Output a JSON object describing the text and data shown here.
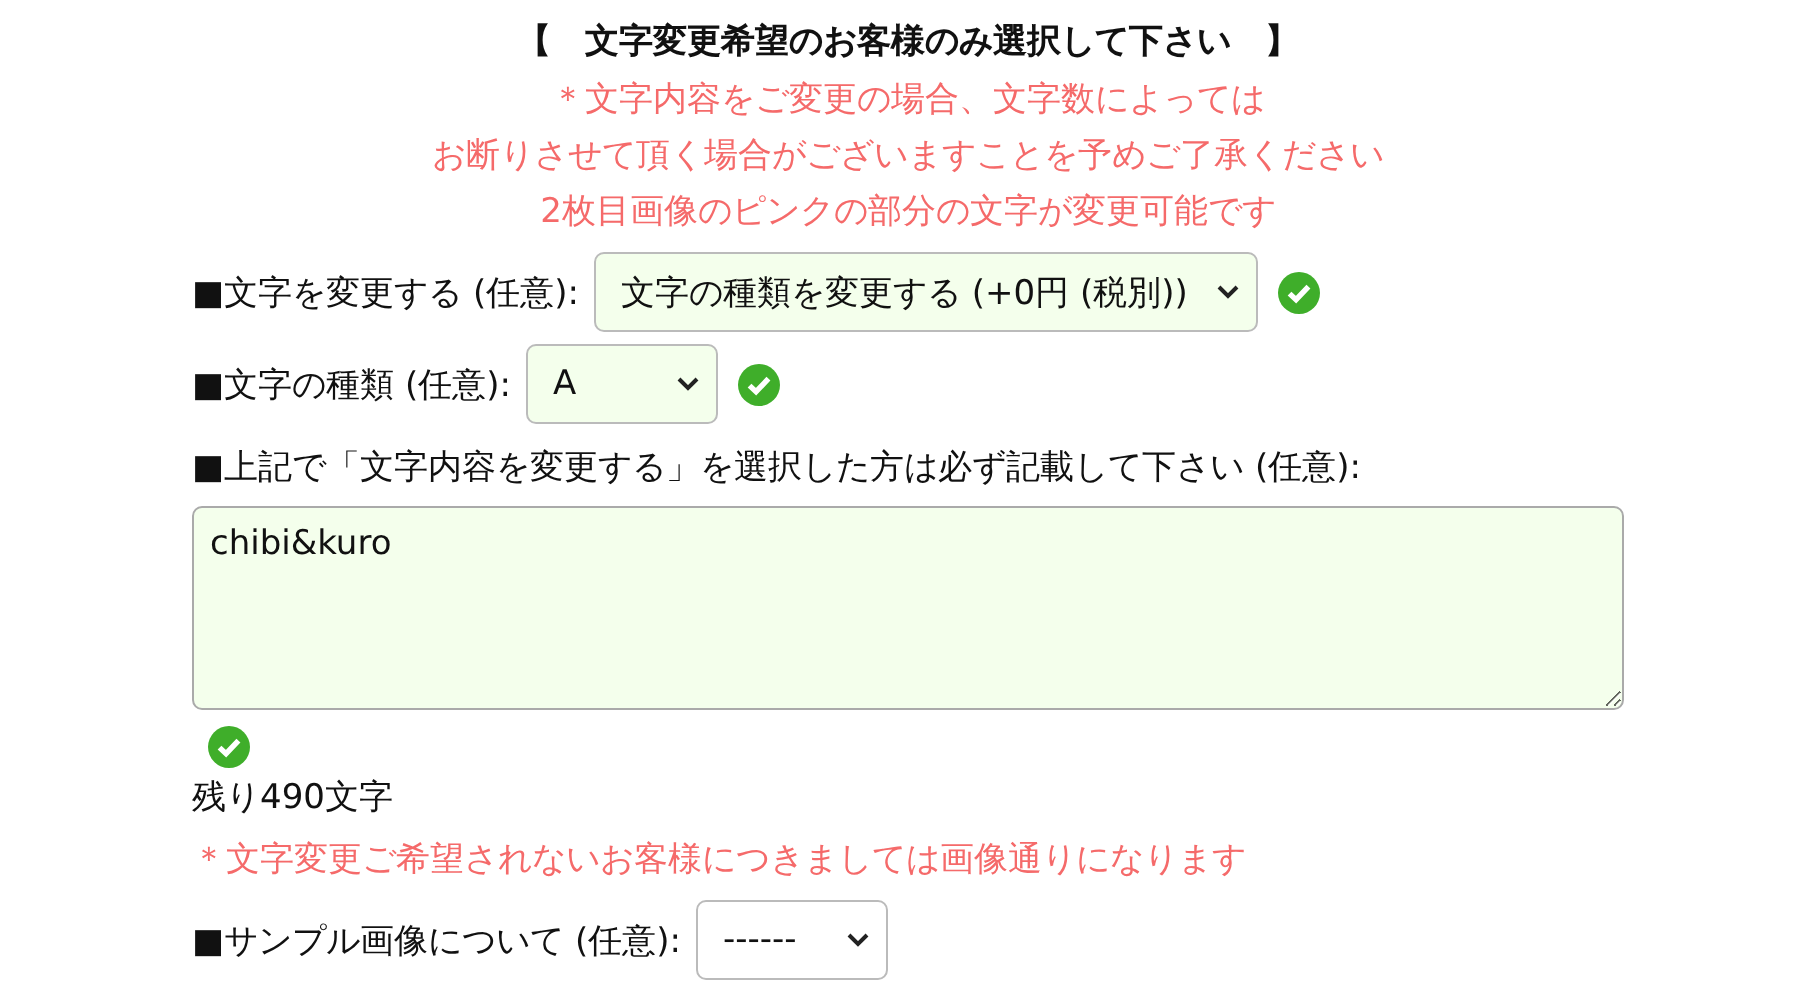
{
  "heading": "【　文字変更希望のお客様のみ選択して下さい　】",
  "notes": [
    "＊文字内容をご変更の場合、文字数によっては",
    "お断りさせて頂く場合がございますことを予めご了承ください",
    "2枚目画像のピンクの部分の文字が変更可能です"
  ],
  "fields": [
    {
      "kind": "select",
      "label": "■文字を変更する (任意):",
      "value": "文字の種類を変更する (+0円 (税別))",
      "valid": true
    },
    {
      "kind": "select",
      "label": "■文字の種類 (任意):",
      "value": "A",
      "valid": true
    },
    {
      "kind": "textarea",
      "label": "■上記で「文字内容を変更する」を選択した方は必ず記載して下さい (任意):",
      "value": "chibi&kuro",
      "valid": true,
      "remaining": "残り490文字"
    },
    {
      "kind": "note",
      "text": "＊文字変更ご希望されないお客様につきましては画像通りになります"
    },
    {
      "kind": "select",
      "label": "■サンプル画像について (任意):",
      "value": "------",
      "valid": false
    }
  ]
}
